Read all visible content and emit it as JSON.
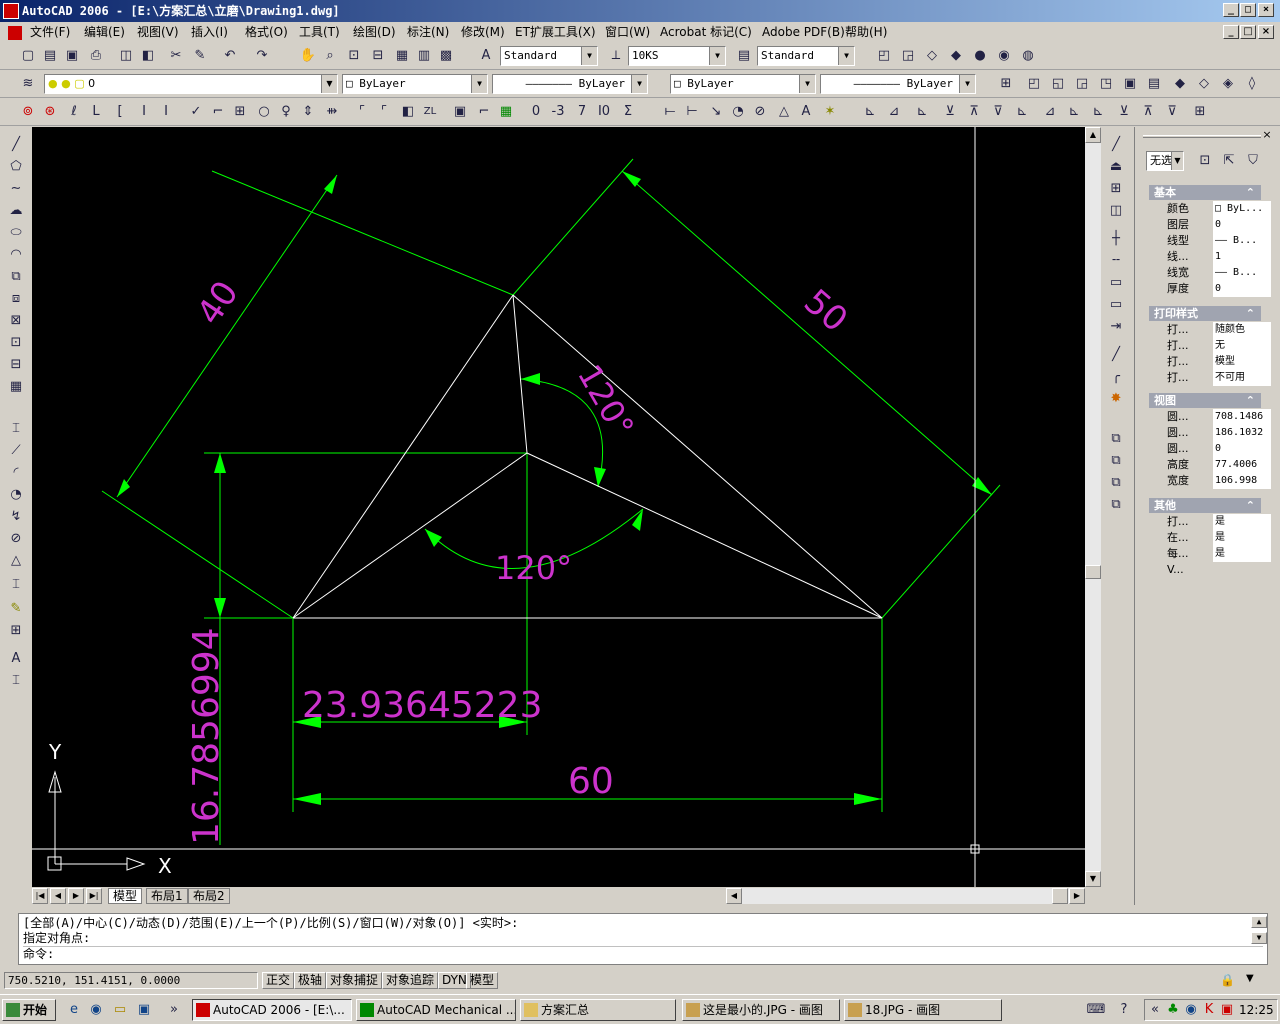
{
  "title": "AutoCAD 2006 - [E:\\方案汇总\\立磨\\Drawing1.dwg]",
  "menu": [
    "文件(F)",
    "编辑(E)",
    "视图(V)",
    "插入(I)",
    "格式(O)",
    "工具(T)",
    "绘图(D)",
    "标注(N)",
    "修改(M)",
    "ET扩展工具(X)",
    "窗口(W)",
    "Acrobat 标记(C)",
    "Adobe PDF(B)",
    "帮助(H)"
  ],
  "toolbar1": {
    "text_style": "Standard",
    "dim_style": "10KS",
    "table_style": "Standard"
  },
  "toolbar2": {
    "layer": "0",
    "color": "ByLayer",
    "linetype": "ByLayer",
    "lineweight": "ByLayer",
    "plotstyle": "ByLayer",
    "linetype2": "ByLayer"
  },
  "toolbar3": {
    "ints": [
      "0",
      "-3",
      "7",
      "I0",
      "Σ"
    ]
  },
  "drawing": {
    "dims": [
      "40",
      "50",
      "120°",
      "120°",
      "23.93645223",
      "16.7856994",
      "60"
    ],
    "ucs_x": "X",
    "ucs_y": "Y"
  },
  "layout_tabs": [
    "模型",
    "布局1",
    "布局2"
  ],
  "properties": {
    "combo": "无选",
    "basic_title": "基本",
    "basic": [
      {
        "k": "颜色",
        "v": "□ ByL..."
      },
      {
        "k": "图层",
        "v": "0"
      },
      {
        "k": "线型",
        "v": "—— B..."
      },
      {
        "k": "线...",
        "v": "1"
      },
      {
        "k": "线宽",
        "v": "—— B..."
      },
      {
        "k": "厚度",
        "v": "0"
      }
    ],
    "plot_title": "打印样式",
    "plot": [
      {
        "k": "打...",
        "v": "随颜色"
      },
      {
        "k": "打...",
        "v": "无"
      },
      {
        "k": "打...",
        "v": "模型"
      },
      {
        "k": "打...",
        "v": "不可用"
      }
    ],
    "view_title": "视图",
    "view": [
      {
        "k": "圆...",
        "v": "708.1486"
      },
      {
        "k": "圆...",
        "v": "186.1032"
      },
      {
        "k": "圆...",
        "v": "0"
      },
      {
        "k": "高度",
        "v": "77.4006"
      },
      {
        "k": "宽度",
        "v": "106.998"
      }
    ],
    "misc_title": "其他",
    "misc": [
      {
        "k": "打...",
        "v": "是"
      },
      {
        "k": "在...",
        "v": "是"
      },
      {
        "k": "每...",
        "v": "是"
      },
      {
        "k": "V...",
        "v": ""
      }
    ]
  },
  "command": {
    "line1": "[全部(A)/中心(C)/动态(D)/范围(E)/上一个(P)/比例(S)/窗口(W)/对象(O)] <实时>:",
    "line2": "指定对角点:",
    "prompt": "命令:"
  },
  "status": {
    "coords": "750.5210, 151.4151, 0.0000",
    "buttons": [
      "正交",
      "极轴",
      "对象捕捉",
      "对象追踪",
      "DYN",
      "模型"
    ]
  },
  "taskbar": {
    "start": "开始",
    "tasks": [
      "AutoCAD 2006 - [E:\\...",
      "AutoCAD Mechanical ...",
      "方案汇总",
      "这是最小的.JPG - 画图",
      "18.JPG - 画图"
    ],
    "clock": "12:25"
  },
  "colors": {
    "dim": "#00ff00",
    "text": "#cc33cc",
    "line": "#ffffff",
    "title": "#0a246a"
  }
}
